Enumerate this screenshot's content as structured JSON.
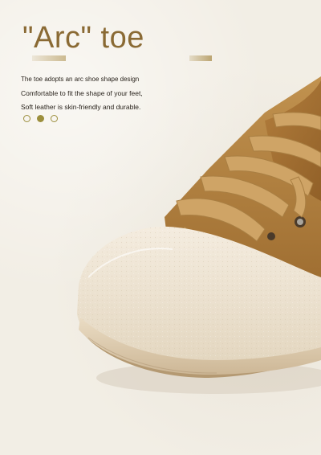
{
  "headline": "\"Arc\" toe",
  "feature_lines": [
    "The toe adopts an arc shoe shape design",
    "Comfortable to fit the shape of your feet,",
    "Soft leather is skin-friendly and durable."
  ],
  "dots": [
    {
      "style": "outline"
    },
    {
      "style": "filled"
    },
    {
      "style": "outline"
    }
  ],
  "colors": {
    "background": "#f2eee5",
    "headline": "#8a6a34",
    "dot": "#9c8f3d",
    "leather": "#b98745",
    "lace": "#cfa466",
    "toe_cap": "#eee4d2"
  }
}
